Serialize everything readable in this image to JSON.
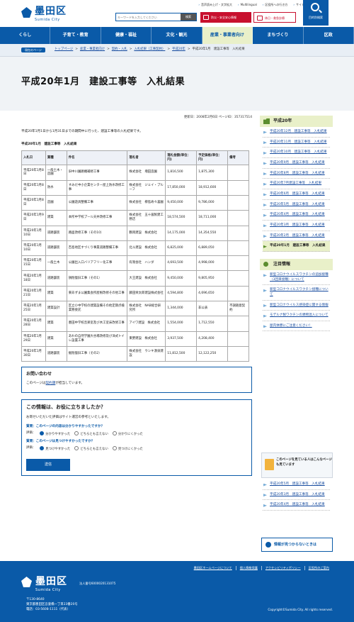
{
  "header": {
    "logo_name": "墨田区",
    "logo_sub": "Sumida City",
    "utility_links": [
      "音声読み上げ・文字拡大",
      "Multilingual",
      "区役所への行き方",
      "サイトマップ"
    ],
    "search_placeholder": "キーワードを入力してください",
    "search_button": "検索",
    "emergency_button": "防災・安全安心情報",
    "holiday_button": "休日・救急診療",
    "purpose_search": "目的別検索"
  },
  "nav": [
    "くらし",
    "子育て・教育",
    "健康・福祉",
    "文化・観光",
    "産業・事業者向け",
    "まちづくり",
    "区政"
  ],
  "breadcrumb": {
    "current_label": "現在のページ",
    "items": [
      "トップページ",
      "産業・事業者向け",
      "契約・入札",
      "入札結果（工事契約）",
      "平成20年",
      "平成20年1月　建設工事等　入札結果"
    ]
  },
  "page_title": "平成20年1月　建設工事等　入札結果",
  "updated": "更新日：2008年2月6日 ページID：357317514",
  "lead": "平成20年1月1日から1月31日までの期間中に行った、建設工事等の入札結果です。",
  "section_title": "平成20年1月　建設工事等　入札結果",
  "table": {
    "headers": [
      "入札日",
      "業種",
      "件名",
      "落札者",
      "落札金額(単位：円)",
      "予定価格(単位：円)",
      "備考"
    ],
    "rows": [
      [
        "平成20年1月8日",
        "一般土木・造園",
        "旧中川園路機補修工事",
        "株式会社　増田造園",
        "1,816,500",
        "1,875,300",
        ""
      ],
      [
        "平成20年1月8日",
        "防水",
        "すみだ中小企業センター屋上防水改修工事",
        "株式会社　ジェイ・プルーフ",
        "17,850,000",
        "18,912,600",
        ""
      ],
      [
        "平成20年1月8日",
        "造園",
        "公園遊具整備工事",
        "株式会社　柳島寿々喜園",
        "9,450,000",
        "9,786,000",
        ""
      ],
      [
        "平成20年1月9日",
        "建築",
        "本所中学校プール天井改修工事",
        "株式会社　五十嵐製建工務店",
        "18,574,500",
        "18,711,000",
        ""
      ],
      [
        "平成20年1月10日",
        "道路舗装",
        "路面改修工事（その10）",
        "鶴岡建設　株式会社",
        "14,175,000",
        "14,354,550",
        ""
      ],
      [
        "平成20年1月10日",
        "道路舗装",
        "百島地区すづくり事業道路整備工事",
        "北斗建設　株式会社",
        "6,825,000",
        "6,889,050",
        ""
      ],
      [
        "平成20年1月15日",
        "一般土木",
        "公園出入口バリアフリー化工事",
        "有限会社　ハンダ",
        "4,693,500",
        "4,998,000",
        ""
      ],
      [
        "平成20年1月18日",
        "道路舗装",
        "損削復旧工事（その1）",
        "大王建設　株式会社",
        "9,450,000",
        "9,805,950",
        ""
      ],
      [
        "平成20年1月21日",
        "建築",
        "東あずま公園集会所屋根改修その他工事",
        "藤田栄太郎建設株式会社",
        "4,594,800",
        "4,696,650",
        ""
      ],
      [
        "平成20年1月25日",
        "建築設計",
        "区立小中学校の建築設備その他定期点検業務委託",
        "株式会社　NAB総合研究所",
        "1,344,000",
        "非公表",
        "不調随意契約"
      ],
      [
        "平成20年1月28日",
        "建築",
        "墨田中学校音楽室及び木工室床改修工事",
        "アイワ建設　株式会社",
        "1,554,000",
        "1,712,550",
        ""
      ],
      [
        "平成20年1月29日",
        "建築",
        "あわの自然学園大谷場改修及び洋式トイレ設置工事",
        "東野建設　株式会社",
        "3,937,500",
        "4,208,400",
        ""
      ],
      [
        "平成20年1月30日",
        "道路舗装",
        "掘削復旧工事（その2）",
        "株式会社　ウシキ湧泉建設",
        "11,812,500",
        "12,122,250",
        ""
      ]
    ]
  },
  "contact": {
    "title": "お問い合わせ",
    "text_pre": "このページは",
    "link": "契約課",
    "text_post": "が担当しています。"
  },
  "feedback": {
    "title": "この情報は、お役に立ちましたか？",
    "intro": "お寄せいただいた評価はサイト運営の参考といたします。",
    "q1": "質問：このページの内容は分かりやすかったですか？",
    "q1_label": "評価：",
    "q1_options": [
      "分かりやすかった",
      "どちらとも言えない",
      "分かりにくかった"
    ],
    "q2": "質問：このページは見つけやすかったですか？",
    "q2_label": "評価：",
    "q2_options": [
      "見つけやすかった",
      "どちらとも言えない",
      "見つけにくかった"
    ],
    "submit": "送信"
  },
  "sidebar": {
    "year_title": "平成20年",
    "year_items": [
      "平成20年12月　建設工事等　入札結果",
      "平成20年11月　建設工事等　入札結果",
      "平成20年10月　建設工事等　入札結果",
      "平成20年9月　建設工事等　入札結果",
      "平成20年8月　建設工事等　入札結果",
      "平成20年7月建設工事等　入札結果",
      "平成20年6月　建設工事等　入札結果",
      "平成20年5月　建設工事等　入札結果",
      "平成20年4月　建設工事等　入札結果",
      "平成20年3月　建設工事等　入札結果",
      "平成20年2月　建設工事等　入札結果",
      "平成20年1月　建設工事等　入札結果"
    ],
    "attention_title": "注目情報",
    "attention_items": [
      "新型コロナウイルスワクチンの追加接種（3回目接種）について",
      "新型コロナウイルスワクチン接種について",
      "新型コロナウイルス感染症に関する情報",
      "モデルナ製ワクチンの異物混入について",
      "屋内休憩にご注意ください！"
    ],
    "other_views": "このページを見ている人はこんなページも見ています",
    "other_links": [
      "平成20年5月　建設工事等　入札結果",
      "平成20年3月　建設工事等　入札結果",
      "平成20年4月　建設工事等　入札結果"
    ],
    "not_found": "情報が見つからないときは"
  },
  "footer": {
    "links": [
      "墨田区ホームページについて",
      "個人情報保護",
      "アクセシビリティポリシー",
      "区役所のご案内"
    ],
    "logo_name": "墨田区",
    "logo_sub": "Sumida City",
    "corp_no": "法人番号6000020131075",
    "address": [
      "〒130-8640",
      "東京都墨田区吾妻橋一丁目23番20号",
      "電話：03-5608-1111（代表）"
    ],
    "copyright": "Copyright©Sumida City. All rights reserved."
  }
}
